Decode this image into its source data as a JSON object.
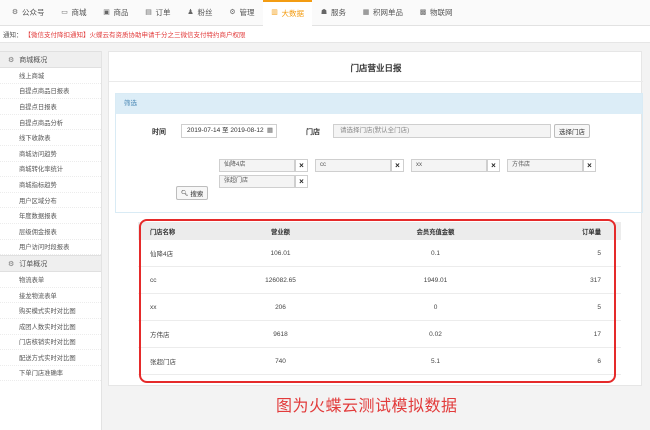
{
  "nav": [
    {
      "icon": "gear-icon",
      "glyph": "⚙",
      "label": "公众号",
      "active": false
    },
    {
      "icon": "monitor-icon",
      "glyph": "▭",
      "label": "商城",
      "active": false
    },
    {
      "icon": "box-icon",
      "glyph": "▣",
      "label": "商品",
      "active": false
    },
    {
      "icon": "document-icon",
      "glyph": "▤",
      "label": "订单",
      "active": false
    },
    {
      "icon": "user-icon",
      "glyph": "♟",
      "label": "粉丝",
      "active": false
    },
    {
      "icon": "settings-icon",
      "glyph": "⚙",
      "label": "管理",
      "active": false
    },
    {
      "icon": "chart-icon",
      "glyph": "▥",
      "label": "大数据",
      "active": true
    },
    {
      "icon": "service-icon",
      "glyph": "☗",
      "label": "服务",
      "active": false
    },
    {
      "icon": "cart-icon",
      "glyph": "▦",
      "label": "积网单品",
      "active": false
    },
    {
      "icon": "grid-icon",
      "glyph": "▩",
      "label": "物联网",
      "active": false
    }
  ],
  "notice": {
    "label": "通知：",
    "text": "【微信支付降扣通知】火蝶云有资质协助申请千分之三微信支付特约商户权限"
  },
  "sidebar": {
    "groups": [
      {
        "title": "商城概况",
        "items": [
          "线上商城",
          "自提点商品日报表",
          "自提点日报表",
          "自提点商品分析",
          "线下收款表",
          "商城访问趋势",
          "商城转化率统计",
          "商城指标趋势",
          "用户区域分布",
          "年度数据报表",
          "层级佣金报表",
          "用户访问时段报表"
        ]
      },
      {
        "title": "订单概况",
        "items": [
          "物流表单",
          "接龙物流表单",
          "购买模式实时对比图",
          "成团人数实时对比图",
          "门店核销实时对比图",
          "配送方式实时对比图",
          "下单门店准确率"
        ]
      }
    ]
  },
  "page": {
    "title": "门店营业日报"
  },
  "filter": {
    "title": "筛选",
    "time_label": "时间",
    "date_range": "2019-07-14 至 2019-08-12",
    "store_label": "门店",
    "store_placeholder": "请选择门店(默认全门店)",
    "select_button": "选择门店",
    "search_button": "搜索",
    "tags": [
      "仙降4店",
      "cc",
      "xx",
      "方伟店",
      "张超门店"
    ]
  },
  "table": {
    "headers": [
      "门店名称",
      "营业额",
      "会员充值金额",
      "订单量"
    ],
    "rows": [
      [
        "仙降4店",
        "106.01",
        "0.1",
        "5"
      ],
      [
        "cc",
        "126082.65",
        "1949.01",
        "317"
      ],
      [
        "xx",
        "206",
        "0",
        "5"
      ],
      [
        "方伟店",
        "9618",
        "0.02",
        "17"
      ],
      [
        "张超门店",
        "740",
        "5.1",
        "6"
      ]
    ]
  },
  "caption": "图为火蝶云测试模拟数据",
  "colors": {
    "accent": "#f39c12",
    "highlight": "#e52a2a",
    "notice": "#e23b3b"
  }
}
